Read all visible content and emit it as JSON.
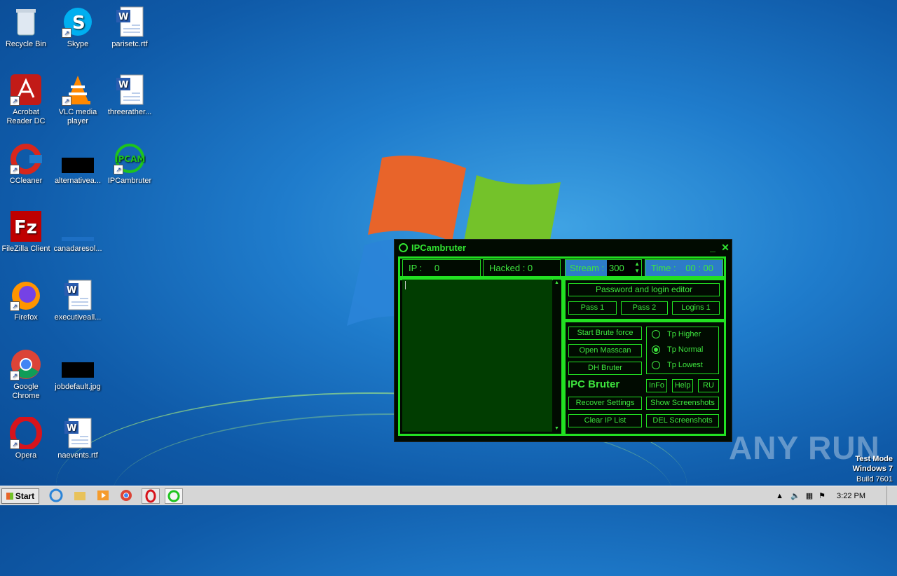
{
  "desktop": {
    "icons": [
      {
        "label": "Recycle Bin",
        "icon": "recycle-bin-icon"
      },
      {
        "label": "Skype",
        "icon": "skype-icon"
      },
      {
        "label": "parisetc.rtf",
        "icon": "word-document-icon"
      },
      {
        "label": "Acrobat Reader DC",
        "icon": "acrobat-icon"
      },
      {
        "label": "VLC media player",
        "icon": "vlc-icon"
      },
      {
        "label": "threerather...",
        "icon": "word-document-icon"
      },
      {
        "label": "CCleaner",
        "icon": "ccleaner-icon"
      },
      {
        "label": "alternativea...",
        "icon": "image-file-icon"
      },
      {
        "label": "IPCambruter",
        "icon": "ipcam-icon"
      },
      {
        "label": "FileZilla Client",
        "icon": "filezilla-icon"
      },
      {
        "label": "canadaresol...",
        "icon": "file-icon"
      },
      {
        "label": "Firefox",
        "icon": "firefox-icon"
      },
      {
        "label": "executiveall...",
        "icon": "word-document-icon"
      },
      {
        "label": "Google Chrome",
        "icon": "chrome-icon"
      },
      {
        "label": "jobdefault.jpg",
        "icon": "image-file-icon"
      },
      {
        "label": "Opera",
        "icon": "opera-icon"
      },
      {
        "label": "naevents.rtf",
        "icon": "word-document-icon"
      }
    ],
    "ipcam_badge": "IPCAM"
  },
  "app": {
    "title": "IPCambruter",
    "minimize": "_",
    "close": "✕",
    "ip_label": "IP :",
    "ip_value": "0",
    "hacked_label": "Hacked : 0",
    "stream_label": "Stream :",
    "stream_value": "300",
    "time_label": "Time :",
    "time_value": "00 : 00",
    "password_editor": "Password and login editor",
    "pass1": "Pass  1",
    "pass2": "Pass  2",
    "logins1": "Logins  1",
    "start_brute": "Start Brute force",
    "open_masscan": "Open Masscan",
    "dh_bruter": "DH Bruter",
    "brand": "IPC Bruter",
    "radios": [
      {
        "label": "Tp  Higher",
        "checked": false
      },
      {
        "label": "Tp  Normal",
        "checked": true
      },
      {
        "label": "Tp  Lowest",
        "checked": false
      }
    ],
    "info": "InFo",
    "help": "Help",
    "ru": "RU",
    "recover_settings": "Recover Settings",
    "show_screenshots": "Show Screenshots",
    "clear_ip_list": "Clear  IP List",
    "del_screenshots": "DEL Screenshots",
    "accent": "#22e022"
  },
  "taskbar": {
    "start": "Start",
    "clock": "3:22 PM"
  },
  "watermark": {
    "anyrun": "ANY RUN",
    "line1": "Test Mode",
    "line2": "Windows 7",
    "line3": "Build 7601"
  }
}
